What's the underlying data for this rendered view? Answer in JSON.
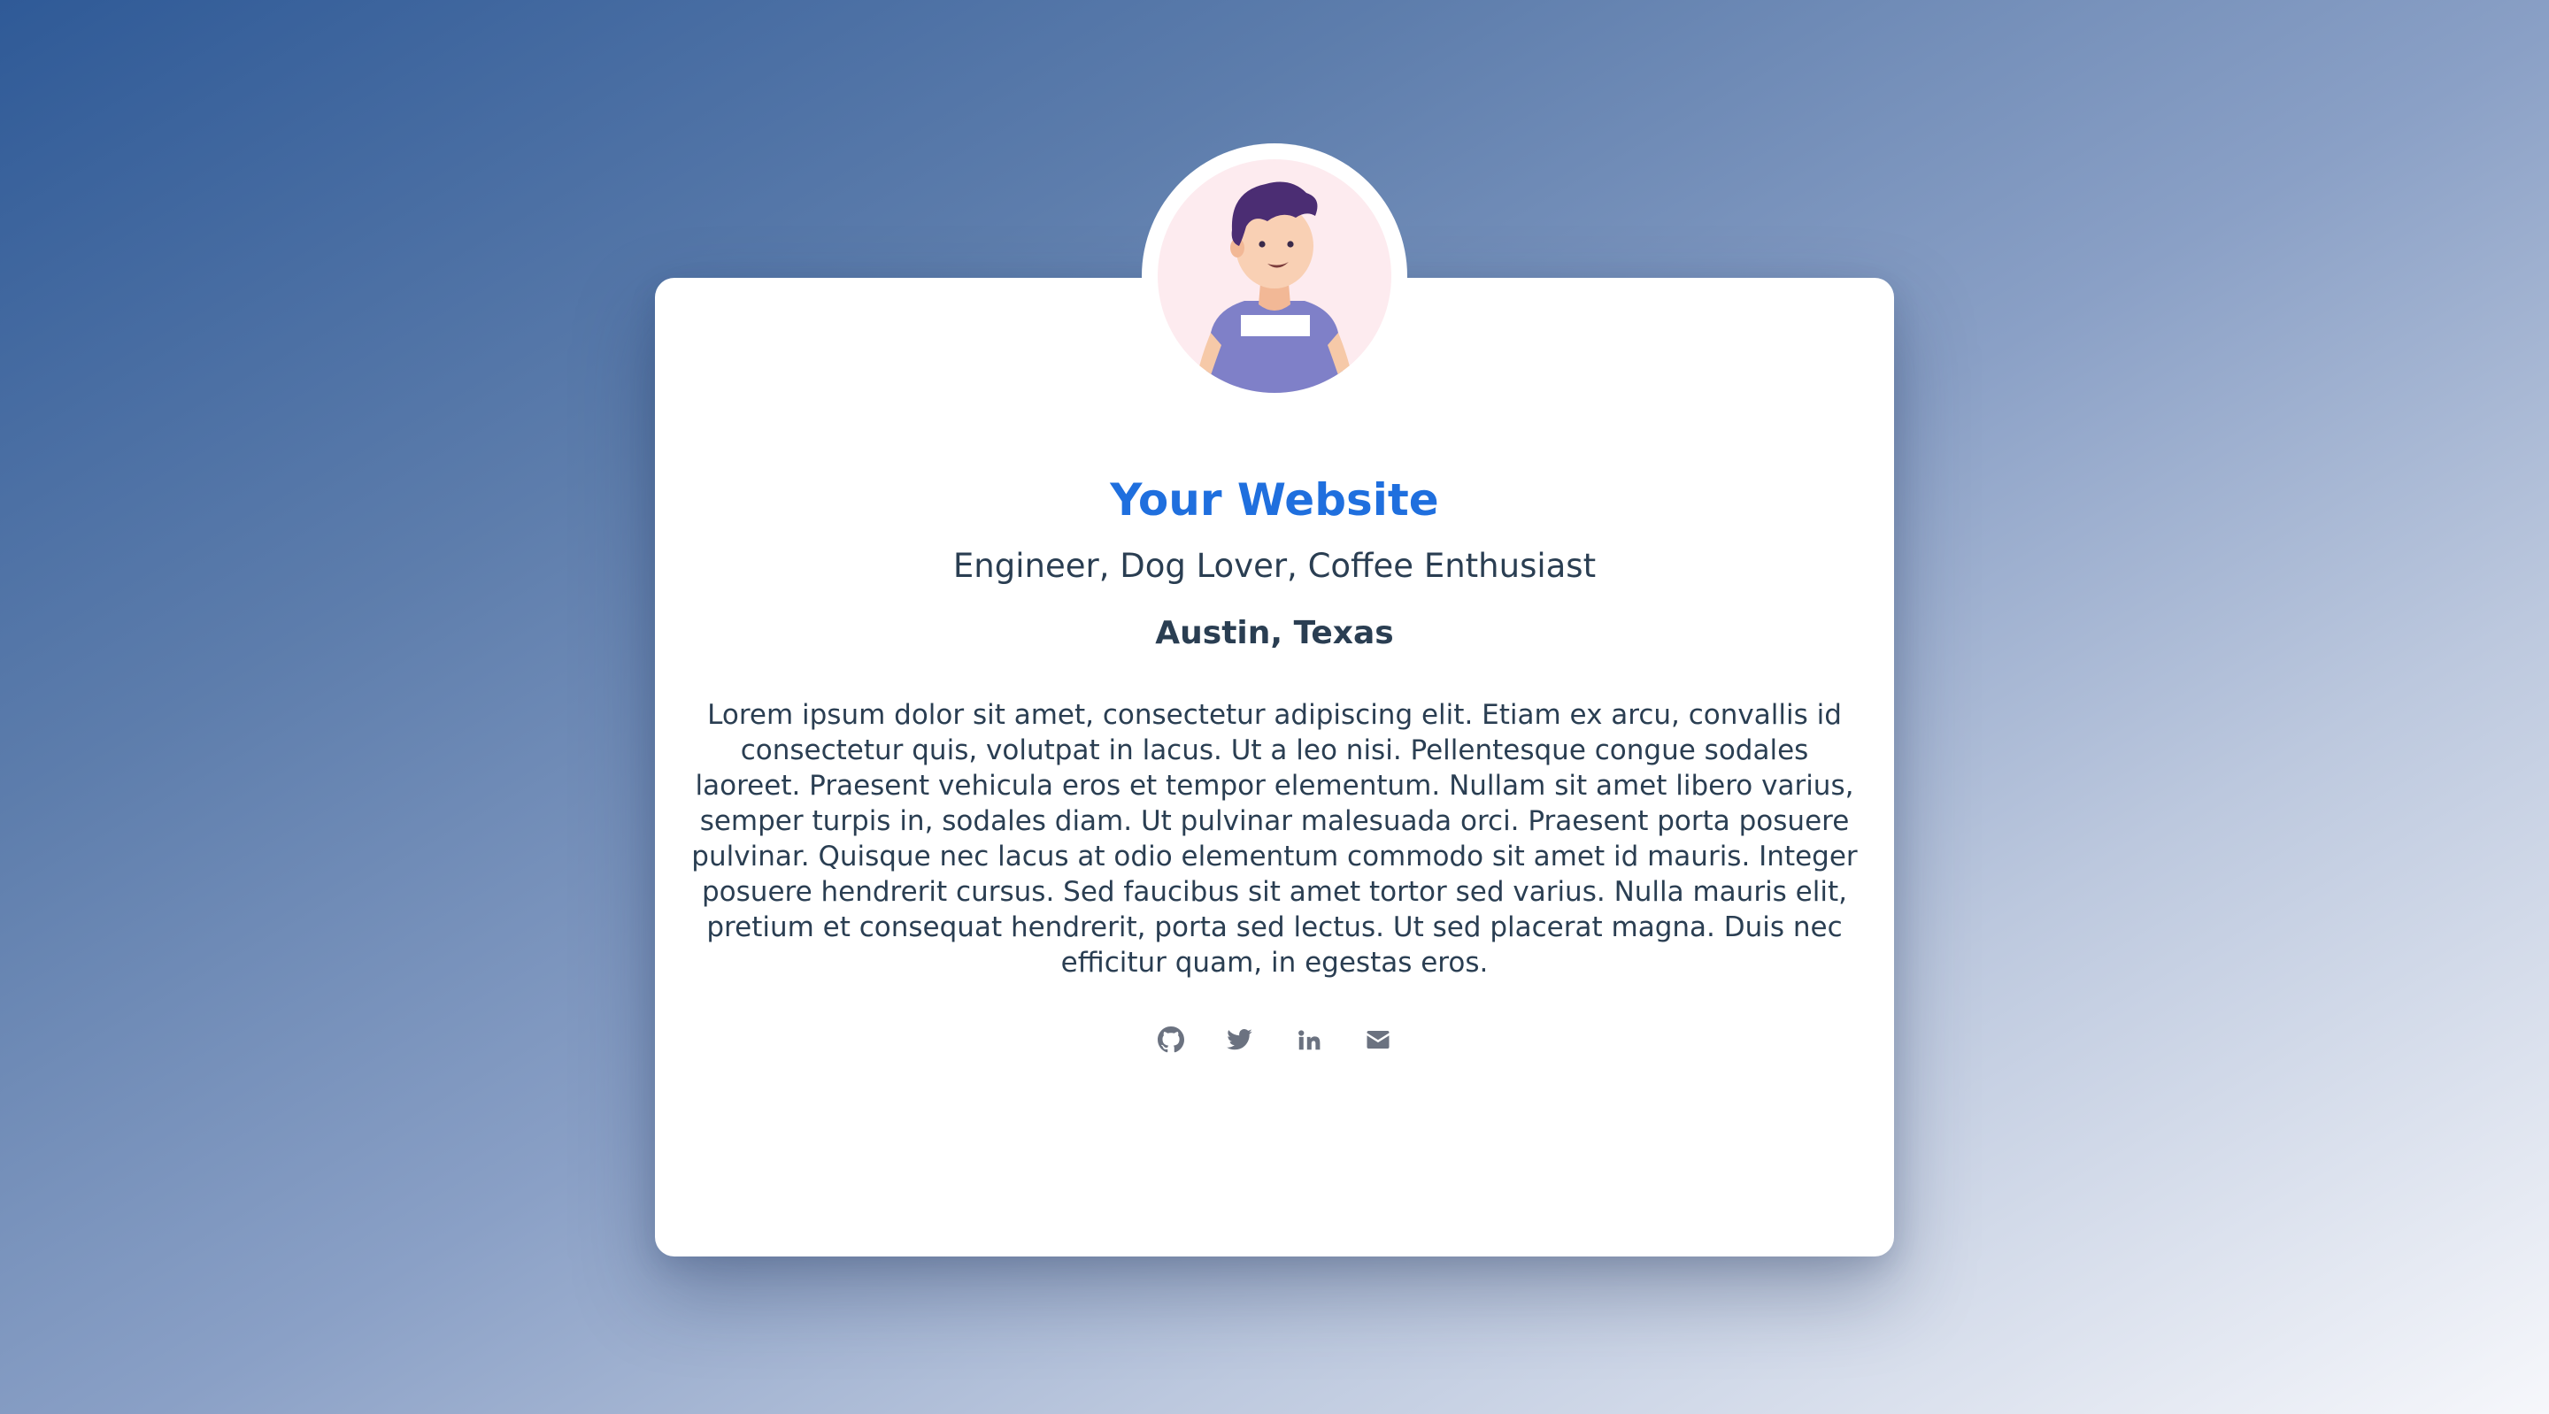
{
  "profile": {
    "title": "Your Website",
    "tagline": "Engineer, Dog Lover, Coffee Enthusiast",
    "location": "Austin, Texas",
    "bio": "Lorem ipsum dolor sit amet, consectetur adipiscing elit. Etiam ex arcu, convallis id consectetur quis, volutpat in lacus. Ut a leo nisi. Pellentesque congue sodales laoreet. Praesent vehicula eros et tempor elementum. Nullam sit amet libero varius, semper turpis in, sodales diam. Ut pulvinar malesuada orci. Praesent porta posuere pulvinar. Quisque nec lacus at odio elementum commodo sit amet id mauris. Integer posuere hendrerit cursus. Sed faucibus sit amet tortor sed varius. Nulla mauris elit, pretium et consequat hendrerit, porta sed lectus. Ut sed placerat magna. Duis nec efficitur quam, in egestas eros.",
    "avatar_icon": "avatar-illustration"
  },
  "socials": [
    {
      "icon": "github-icon"
    },
    {
      "icon": "twitter-icon"
    },
    {
      "icon": "linkedin-icon"
    },
    {
      "icon": "email-icon"
    }
  ],
  "colors": {
    "title": "#1f6fde",
    "text": "#2a3e52",
    "icon": "#6b7280",
    "avatar_bg": "#fdebef"
  }
}
